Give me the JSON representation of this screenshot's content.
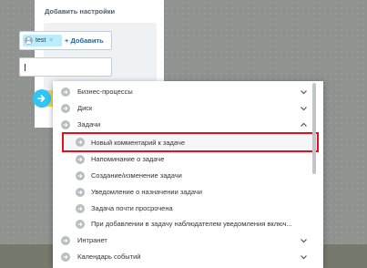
{
  "settings_panel": {
    "title": "Добавить настройки",
    "tag": {
      "label": "test",
      "remove": "×"
    },
    "add_link": "+ Добавить",
    "input_value": ""
  },
  "dropdown": {
    "items": [
      {
        "label": "Бизнес-процессы",
        "state": "collapsed"
      },
      {
        "label": "Диск",
        "state": "collapsed"
      },
      {
        "label": "Задачи",
        "state": "expanded"
      },
      {
        "label": "Новый комментарий к задаче",
        "selected": true
      },
      {
        "label": "Напоминание о задаче"
      },
      {
        "label": "Создание/изменение задачи"
      },
      {
        "label": "Уведомление о назначении задачи"
      },
      {
        "label": "Задача почти просрочена"
      },
      {
        "label": "При добавлении в задачу наблюдателем уведомления включ..."
      },
      {
        "label": "Интранет",
        "state": "collapsed"
      },
      {
        "label": "Календарь событий",
        "state": "collapsed"
      }
    ]
  },
  "colors": {
    "accent_blue": "#2fc6f6",
    "highlight_border": "#e3101b",
    "link": "#2067b0"
  }
}
